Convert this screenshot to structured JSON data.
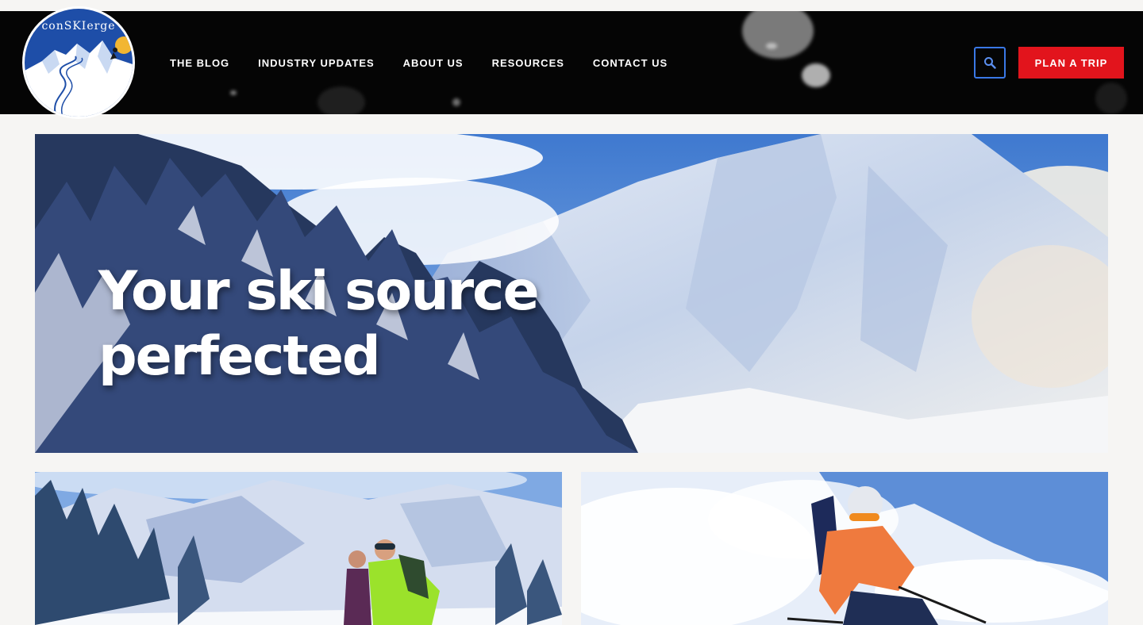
{
  "brand": {
    "logo_text": "conSKIerge"
  },
  "nav": {
    "items": [
      {
        "label": "THE BLOG"
      },
      {
        "label": "INDUSTRY UPDATES"
      },
      {
        "label": "ABOUT US"
      },
      {
        "label": "RESOURCES"
      },
      {
        "label": "CONTACT US"
      }
    ]
  },
  "header": {
    "search_icon": "search-icon",
    "cta_label": "PLAN A TRIP"
  },
  "hero": {
    "title_line1": "Your ski source",
    "title_line2": "perfected",
    "image": "snowy-mountain-with-pine-trees"
  },
  "cards": [
    {
      "image": "two-skiers-posing-in-snowy-mountains"
    },
    {
      "image": "skier-in-orange-jacket-carving-powder"
    }
  ],
  "colors": {
    "header_bg": "#050505",
    "cta": "#e2141c",
    "search_border": "#3a78e6",
    "logo_blue": "#1e4ea8",
    "page_bg": "#f6f5f3"
  }
}
